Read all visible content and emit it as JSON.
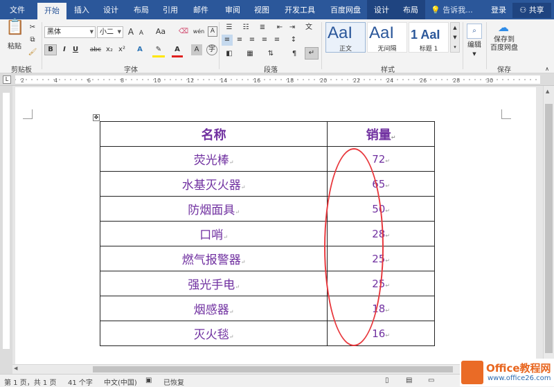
{
  "menu": {
    "tabs": [
      "文件",
      "开始",
      "插入",
      "设计",
      "布局",
      "引用",
      "邮件",
      "审阅",
      "视图",
      "开发工具",
      "百度网盘"
    ],
    "context_tabs": [
      "设计",
      "布局"
    ],
    "tell_me": "告诉我...",
    "login": "登录",
    "share": "共享"
  },
  "ribbon": {
    "clipboard": {
      "paste": "粘贴",
      "group": "剪贴板"
    },
    "font": {
      "name": "黑体",
      "size": "小二",
      "group": "字体",
      "grow": "A",
      "shrink": "A",
      "case": "Aa",
      "phonetic": "wén",
      "bold": "B",
      "italic": "I",
      "underline": "U",
      "strike": "abc",
      "sub": "x₂",
      "sup": "x²"
    },
    "paragraph": {
      "group": "段落"
    },
    "styles": {
      "group": "样式",
      "items": [
        {
          "sample": "AaI",
          "name": "正文"
        },
        {
          "sample": "AaI",
          "name": "无间隔"
        },
        {
          "sample": "1 AaI",
          "name": "标题 1"
        }
      ]
    },
    "editing": {
      "label": "编辑"
    },
    "save": {
      "label1": "保存到",
      "label2": "百度网盘",
      "group": "保存"
    }
  },
  "ruler_marks": [
    "2",
    "4",
    "6",
    "8",
    "10",
    "12",
    "14",
    "16",
    "18",
    "20",
    "22",
    "24",
    "26",
    "28",
    "30"
  ],
  "table": {
    "headers": [
      "名称",
      "销量"
    ],
    "rows": [
      [
        "荧光棒",
        "72"
      ],
      [
        "水基灭火器",
        "65"
      ],
      [
        "防烟面具",
        "50"
      ],
      [
        "口哨",
        "28"
      ],
      [
        "燃气报警器",
        "25"
      ],
      [
        "强光手电",
        "25"
      ],
      [
        "烟感器",
        "18"
      ],
      [
        "灭火毯",
        "16"
      ]
    ]
  },
  "colors": {
    "accent": "#2b579a",
    "table_text": "#7030a0",
    "highlight": "#e8383d"
  },
  "status": {
    "page": "第 1 页，共 1 页",
    "words": "41 个字",
    "lang": "中文(中国)",
    "recovered": "已恢复"
  },
  "watermark": {
    "line1": "Office教程网",
    "line2": "www.office26.com"
  }
}
